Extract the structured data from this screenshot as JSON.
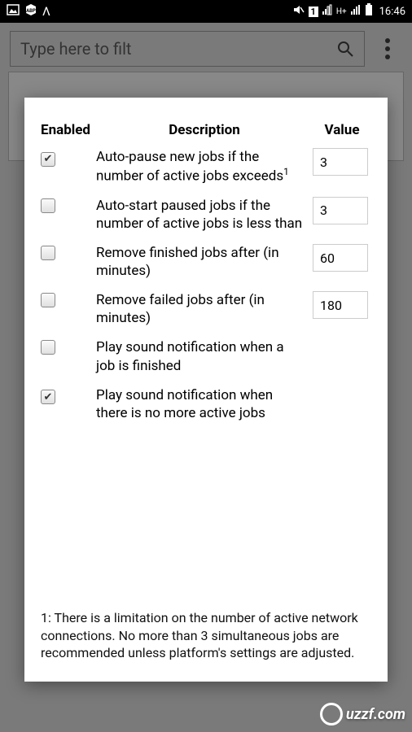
{
  "status": {
    "clock": "16:46",
    "sim": "1",
    "net": "H+"
  },
  "search": {
    "placeholder": "Type here to filt"
  },
  "headers": {
    "enabled": "Enabled",
    "description": "Description",
    "value": "Value"
  },
  "rows": [
    {
      "checked": true,
      "desc": "Auto-pause new jobs if the number of active jobs exceeds",
      "sup": "1",
      "value": "3"
    },
    {
      "checked": false,
      "desc": "Auto-start paused jobs if the number of active jobs is less than",
      "value": "3"
    },
    {
      "checked": false,
      "desc": "Remove finished jobs after (in minutes)",
      "value": "60"
    },
    {
      "checked": false,
      "desc": "Remove failed jobs after (in minutes)",
      "value": "180"
    },
    {
      "checked": false,
      "desc": "Play sound notification when a job is finished"
    },
    {
      "checked": true,
      "desc": "Play sound notification when there is no more active jobs"
    }
  ],
  "footnote": "1: There is a limitation on the number of active network connections. No more than 3 simultaneous jobs are recommended unless platform's settings are adjusted.",
  "watermark": "uzzf.com"
}
